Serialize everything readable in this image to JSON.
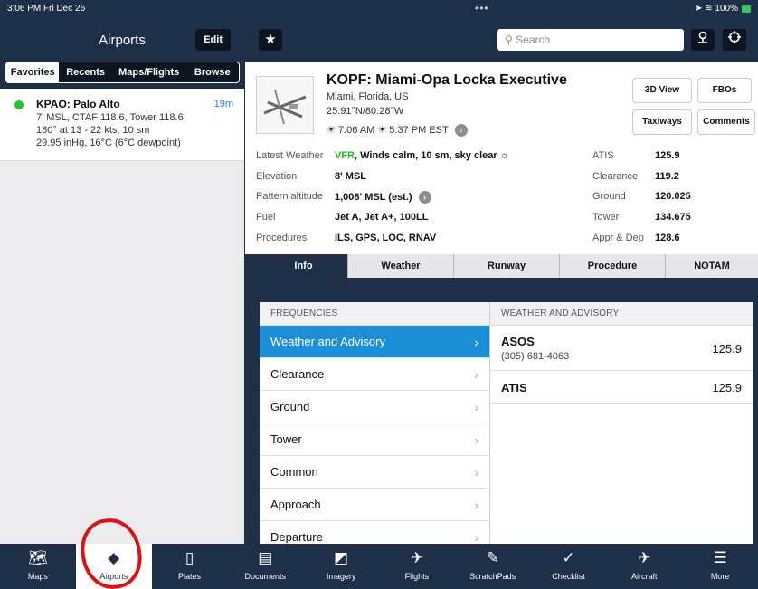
{
  "status_bar": {
    "time_date": "3:06 PM  Fri Dec 26",
    "dots": "•••",
    "signal": "➤ ≋ 100%"
  },
  "left_panel": {
    "title": "Airports",
    "edit_label": "Edit",
    "segments": [
      "Favorites",
      "Recents",
      "Maps/Flights",
      "Browse"
    ],
    "favorite": {
      "name": "KPAO: Palo Alto",
      "time": "19m",
      "line1": "7' MSL, CTAF 118.6, Tower 118.6",
      "line2": "180° at 13 - 22 kts, 10 sm",
      "line3": "29.95 inHg, 16°C (6°C dewpoint)"
    }
  },
  "header": {
    "search_placeholder": "Search",
    "icons": [
      "star-icon",
      "search-icon",
      "pin-icon",
      "target-icon"
    ]
  },
  "airport": {
    "title": "KOPF: Miami-Opa Locka Executive",
    "city": "Miami, Florida, US",
    "coords": "25.91°N/80.28°W",
    "sunrise": "7:06 AM",
    "sunset": "5:37 PM EST",
    "buttons": {
      "view3d": "3D View",
      "fbos": "FBOs",
      "taxiways": "Taxiways",
      "comments": "Comments"
    },
    "details": [
      {
        "label": "Latest Weather",
        "value_prefix": "VFR",
        "value": ", Winds calm, 10 sm, sky clear"
      },
      {
        "label": "Elevation",
        "value": "8' MSL"
      },
      {
        "label": "Pattern altitude",
        "value": "1,008' MSL (est.)"
      },
      {
        "label": "Fuel",
        "value": "Jet A, Jet A+, 100LL"
      },
      {
        "label": "Procedures",
        "value": "ILS, GPS, LOC, RNAV"
      }
    ],
    "freqs": [
      {
        "label": "ATIS",
        "value": "125.9"
      },
      {
        "label": "Clearance",
        "value": "119.2"
      },
      {
        "label": "Ground",
        "value": "120.025"
      },
      {
        "label": "Tower",
        "value": "134.675"
      },
      {
        "label": "Appr & Dep",
        "value": "128.6"
      }
    ]
  },
  "tabs": [
    "Info",
    "Weather",
    "Runway",
    "Procedure",
    "NOTAM"
  ],
  "frequencies": {
    "header": "FREQUENCIES",
    "items": [
      "Weather and Advisory",
      "Clearance",
      "Ground",
      "Tower",
      "Common",
      "Approach",
      "Departure"
    ]
  },
  "weather_advisory": {
    "header": "WEATHER AND ADVISORY",
    "items": [
      {
        "name": "ASOS",
        "phone": "(305) 681-4063",
        "freq": "125.9"
      },
      {
        "name": "ATIS",
        "freq": "125.9"
      }
    ]
  },
  "toolbar": [
    "Maps",
    "Airports",
    "Plates",
    "Documents",
    "Imagery",
    "Flights",
    "ScratchPads",
    "Checklist",
    "Aircraft",
    "More"
  ]
}
